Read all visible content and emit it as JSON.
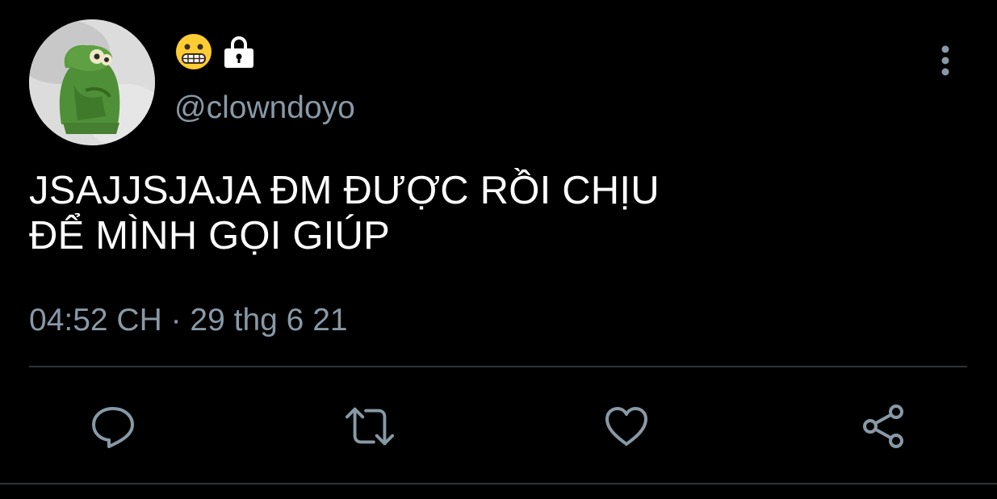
{
  "author": {
    "display_name_emoji": "grimacing-face-emoji",
    "handle": "@clowndoyo",
    "protected": true
  },
  "tweet": {
    "text_line1": "JSAJJSJAJA ĐM ĐƯỢC RỒI CHỊU",
    "text_line2": "ĐỂ MÌNH GỌI GIÚP",
    "timestamp": "04:52 CH · 29 thg 6 21"
  },
  "actions": [
    "reply-icon",
    "retweet-icon",
    "like-icon",
    "share-icon"
  ],
  "colors": {
    "background": "#000000",
    "text": "#ffffff",
    "secondary": "#8899a6",
    "divider": "#2f3336"
  }
}
